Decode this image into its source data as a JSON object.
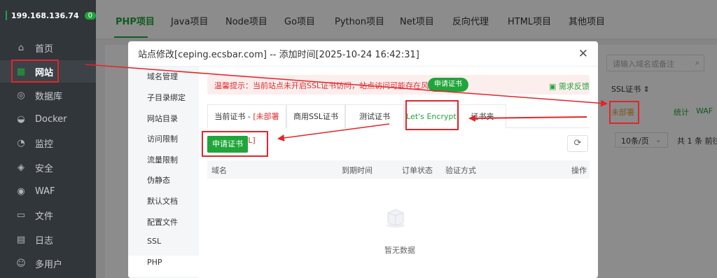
{
  "sidebar": {
    "ip": "199.168.136.74",
    "badge": "0",
    "items": [
      {
        "label": "首页",
        "icon": "home-icon",
        "glyph": "⌂"
      },
      {
        "label": "网站",
        "icon": "website-icon",
        "glyph": "▦",
        "active": true
      },
      {
        "label": "数据库",
        "icon": "database-icon",
        "glyph": "◎"
      },
      {
        "label": "Docker",
        "icon": "docker-icon",
        "glyph": "◒"
      },
      {
        "label": "监控",
        "icon": "monitor-icon",
        "glyph": "◔"
      },
      {
        "label": "安全",
        "icon": "shield-icon",
        "glyph": "◈"
      },
      {
        "label": "WAF",
        "icon": "waf-icon",
        "glyph": "◉"
      },
      {
        "label": "文件",
        "icon": "folder-icon",
        "glyph": "▭"
      },
      {
        "label": "日志",
        "icon": "log-icon",
        "glyph": "▤"
      },
      {
        "label": "多用户",
        "icon": "users-icon",
        "glyph": "☺"
      }
    ]
  },
  "topTabs": [
    "PHP项目",
    "Java项目",
    "Node项目",
    "Go项目",
    "Python项目",
    "Net项目",
    "反向代理",
    "HTML项目",
    "其他项目"
  ],
  "background": {
    "searchPlaceholder": "请输入域名或备注",
    "sslHeader": "SSL证书 ⇕",
    "sslValue": "未部署",
    "statsLink": "统计",
    "wafLink": "WAF",
    "pageSize": "10条/页",
    "total": "共 1 条  前往"
  },
  "modal": {
    "title": "站点修改[ceping.ecsbar.com] -- 添加时间[2025-10-24 16:42:31]",
    "nav": [
      "域名管理",
      "子目录绑定",
      "网站目录",
      "访问限制",
      "流量限制",
      "伪静态",
      "默认文档",
      "配置文件",
      "SSL",
      "PHP"
    ],
    "tip": "温馨提示：当前站点未开启SSL证书访问，站点访问可能存在风险",
    "tipButton": "申请证书",
    "feedback": "需求反馈",
    "tabs": {
      "current": "当前证书 - ",
      "currentStatus": "[未部署SSL]",
      "commercial": "商用SSL证书",
      "test": "测试证书",
      "letsencrypt": "Let's Encrypt",
      "folder": "证书夹"
    },
    "applyButton": "申请证书",
    "table": {
      "columns": [
        "域名",
        "到期时间",
        "订单状态",
        "验证方式",
        "操作"
      ]
    },
    "emptyText": "暂无数据"
  },
  "colors": {
    "accent": "#20a53a",
    "danger": "#e02d2d",
    "annotation": "#e0262a"
  }
}
